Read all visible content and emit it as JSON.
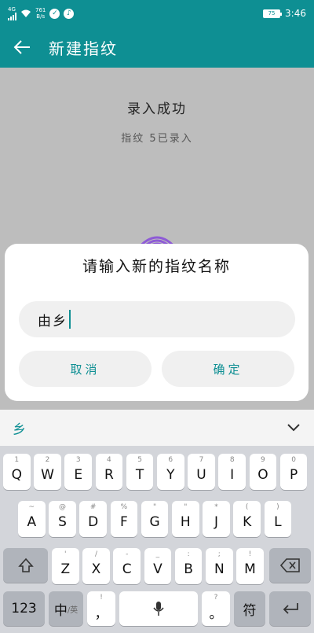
{
  "status_bar": {
    "network": "4G",
    "speed_value": "761",
    "speed_unit": "B/s",
    "battery": "75",
    "time": "3:46"
  },
  "toolbar": {
    "title": "新建指纹"
  },
  "content": {
    "title": "录入成功",
    "subtitle": "指纹 5已录入"
  },
  "dialog": {
    "title": "请输入新的指纹名称",
    "input_value": "由乡",
    "cancel_label": "取消",
    "ok_label": "确定"
  },
  "keyboard": {
    "candidate": "乡",
    "row1": [
      {
        "main": "Q",
        "sub": "1"
      },
      {
        "main": "W",
        "sub": "2"
      },
      {
        "main": "E",
        "sub": "3"
      },
      {
        "main": "R",
        "sub": "4"
      },
      {
        "main": "T",
        "sub": "5"
      },
      {
        "main": "Y",
        "sub": "6"
      },
      {
        "main": "U",
        "sub": "7"
      },
      {
        "main": "I",
        "sub": "8"
      },
      {
        "main": "O",
        "sub": "9"
      },
      {
        "main": "P",
        "sub": "0"
      }
    ],
    "row2": [
      {
        "main": "A",
        "sub": "~"
      },
      {
        "main": "S",
        "sub": "@"
      },
      {
        "main": "D",
        "sub": "#"
      },
      {
        "main": "F",
        "sub": "%"
      },
      {
        "main": "G",
        "sub": "\""
      },
      {
        "main": "H",
        "sub": "\""
      },
      {
        "main": "J",
        "sub": "*"
      },
      {
        "main": "K",
        "sub": "("
      },
      {
        "main": "L",
        "sub": ")"
      }
    ],
    "row3": [
      {
        "main": "Z",
        "sub": "'"
      },
      {
        "main": "X",
        "sub": "/"
      },
      {
        "main": "C",
        "sub": "-"
      },
      {
        "main": "V",
        "sub": "_"
      },
      {
        "main": "B",
        "sub": ":"
      },
      {
        "main": "N",
        "sub": ";"
      },
      {
        "main": "M",
        "sub": "!"
      }
    ],
    "key_123": "123",
    "key_lang_main": "中",
    "key_lang_sub": "/英",
    "key_comma": "，",
    "key_comma_sub": "!",
    "key_period": "。",
    "key_period_sub": "?",
    "key_symbol": "符"
  }
}
